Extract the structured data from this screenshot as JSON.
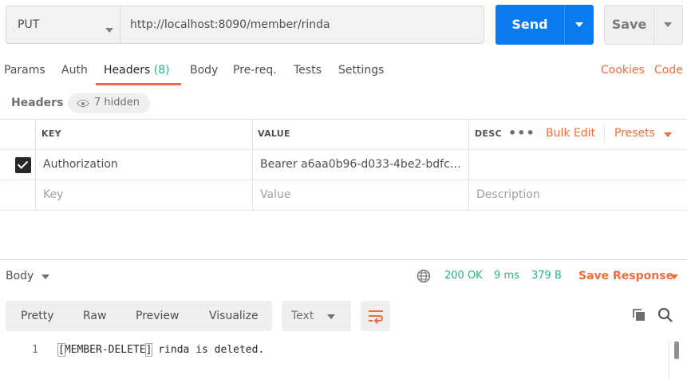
{
  "request": {
    "method": "PUT",
    "url": "http://localhost:8090/member/rinda",
    "send_label": "Send",
    "save_label": "Save"
  },
  "tabs": [
    {
      "label": "Params"
    },
    {
      "label": "Auth"
    },
    {
      "label": "Headers",
      "count": "(8)",
      "active": true
    },
    {
      "label": "Body"
    },
    {
      "label": "Pre-req."
    },
    {
      "label": "Tests"
    },
    {
      "label": "Settings"
    }
  ],
  "links": {
    "cookies": "Cookies",
    "code": "Code"
  },
  "headers_section": {
    "label": "Headers",
    "hidden": "7 hidden"
  },
  "table": {
    "columns": {
      "key": "KEY",
      "value": "VALUE",
      "description": "DESC"
    },
    "bulk_edit": "Bulk Edit",
    "presets": "Presets",
    "rows": [
      {
        "checked": true,
        "key": "Authorization",
        "value": "Bearer a6aa0b96-d033-4be2-bdfc-…",
        "description": ""
      }
    ],
    "placeholders": {
      "key": "Key",
      "value": "Value",
      "description": "Description"
    }
  },
  "response": {
    "body_label": "Body",
    "status": "200 OK",
    "time": "9 ms",
    "size": "379 B",
    "save_response": "Save Response",
    "view_tabs": [
      "Pretty",
      "Raw",
      "Preview",
      "Visualize"
    ],
    "format": "Text",
    "lines": [
      {
        "num": "1",
        "open": "[",
        "tag": "MEMBER-DELETE",
        "close": "]",
        "rest": " rinda is deleted."
      }
    ]
  },
  "colors": {
    "accent": "#f26b3a",
    "send_blue": "#097bed",
    "status_green": "#26b47f"
  }
}
